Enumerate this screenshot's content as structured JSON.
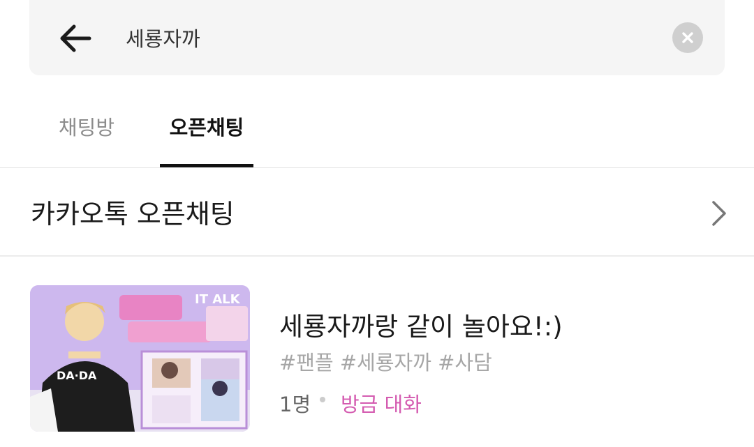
{
  "search": {
    "query": "세룡자까"
  },
  "tabs": [
    {
      "label": "채팅방",
      "active": false
    },
    {
      "label": "오픈채팅",
      "active": true
    }
  ],
  "section": {
    "title": "카카오톡 오픈채팅"
  },
  "results": [
    {
      "title": "세룡자까랑 같이 놀아요!:)",
      "tags": "#팬플 #세룡자까 #사담",
      "members": "1명",
      "activity": "방금 대화",
      "thumbnail_overlay_text": "IT ALK"
    }
  ],
  "colors": {
    "search_bg": "#f5f5f5",
    "activity_pink": "#d45bb0",
    "tag_gray": "#a6a6a6",
    "active_tab": "#111111"
  },
  "icons": {
    "back": "arrow-left-icon",
    "clear": "clear-circle-icon",
    "chevron": "chevron-right-icon"
  }
}
